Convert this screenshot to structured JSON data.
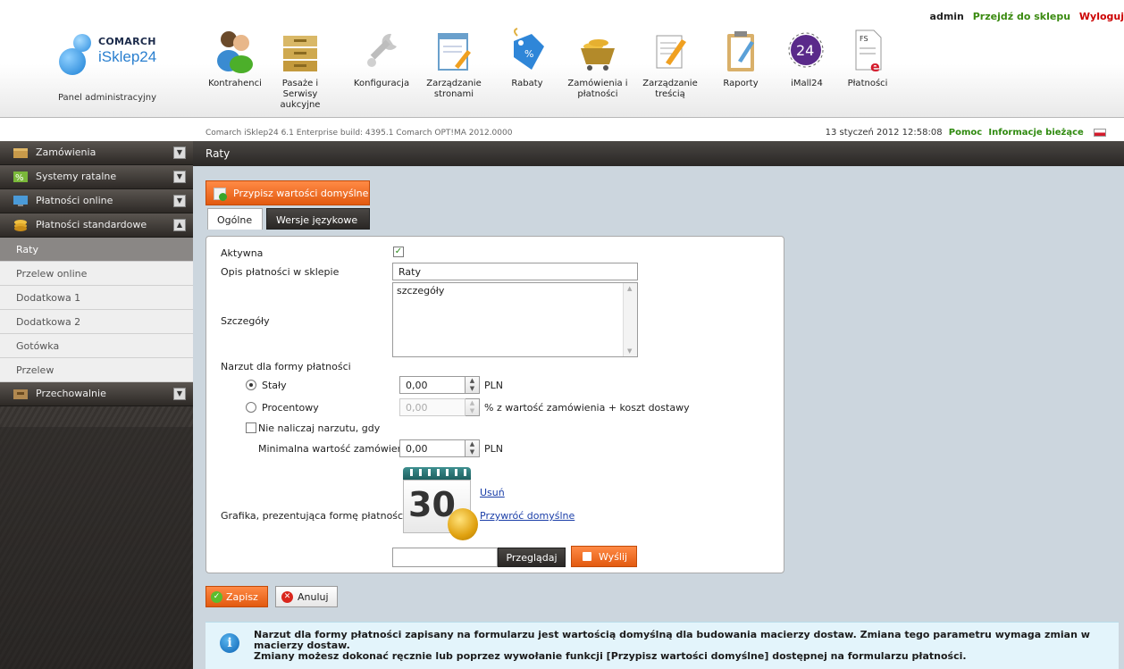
{
  "header": {
    "user": "admin",
    "go_to_shop": "Przejdź do sklepu",
    "logout": "Wyloguj",
    "logo_top": "COMARCH",
    "logo_bottom": "iSklep24",
    "panel_label": "Panel administracyjny"
  },
  "nav": [
    {
      "label": "Kontrahenci",
      "icon": "people-icon"
    },
    {
      "label": "Pasaże i Serwisy aukcyjne",
      "icon": "boxes-icon"
    },
    {
      "label": "Konfiguracja",
      "icon": "wrench-icon"
    },
    {
      "label": "Zarządzanie stronami",
      "icon": "page-edit-icon"
    },
    {
      "label": "Rabaty",
      "icon": "discount-tag-icon"
    },
    {
      "label": "Zamówienia i płatności",
      "icon": "cart-icon"
    },
    {
      "label": "Zarządzanie treścią",
      "icon": "content-edit-icon"
    },
    {
      "label": "Raporty",
      "icon": "clipboard-icon"
    },
    {
      "label": "iMall24",
      "icon": "imall24-icon",
      "badge": "24"
    },
    {
      "label": "Płatności",
      "icon": "fs-e-icon",
      "badge": "FS"
    }
  ],
  "buildbar": {
    "prefix": "Comarch iSklep24 6.1 Enterprise build: 4395.1 Comarch OPT!MA 2012.0000",
    "datetime": "13 styczeń 2012 12:58:08",
    "help": "Pomoc",
    "news": "Informacje bieżące"
  },
  "sidebar": {
    "groups": [
      {
        "label": "Zamówienia",
        "icon": "box-icon"
      },
      {
        "label": "Systemy ratalne",
        "icon": "percent-icon"
      },
      {
        "label": "Płatności online",
        "icon": "monitor-icon"
      },
      {
        "label": "Płatności standardowe",
        "icon": "coins-icon"
      }
    ],
    "sub_items": [
      "Raty",
      "Przelew online",
      "Dodatkowa 1",
      "Dodatkowa 2",
      "Gotówka",
      "Przelew"
    ],
    "last_group": {
      "label": "Przechowalnie",
      "icon": "storage-icon"
    }
  },
  "page": {
    "title": "Raty",
    "defaults_button": "Przypisz wartości domyślne",
    "tabs": [
      "Ogólne",
      "Wersje językowe"
    ]
  },
  "form": {
    "active_label": "Aktywna",
    "desc_label": "Opis płatności w sklepie",
    "desc_value": "Raty",
    "details_label": "Szczegóły",
    "details_value": "szczegóły",
    "surcharge_label": "Narzut dla formy płatności",
    "fixed_label": "Stały",
    "fixed_value": "0,00",
    "currency": "PLN",
    "percent_label": "Procentowy",
    "percent_value": "0,00",
    "percent_suffix": "% z wartość zamówienia + koszt dostawy",
    "no_surcharge_label": "Nie naliczaj narzutu, gdy",
    "min_order_label": "Minimalna wartość zamówienia",
    "min_order_value": "0,00",
    "graphic_label": "Grafika, prezentująca formę płatności",
    "calendar_number": "30",
    "remove_link": "Usuń",
    "restore_link": "Przywróć domyślne",
    "browse_button": "Przeglądaj",
    "send_button": "Wyślij"
  },
  "actions": {
    "save": "Zapisz",
    "cancel": "Anuluj"
  },
  "info": {
    "text1": "Narzut dla formy płatności zapisany na formularzu jest wartością domyślną dla budowania macierzy dostaw. Zmiana tego parametru wymaga zmian w macierzy dostaw.",
    "text2": "Zmiany możesz dokonać ręcznie lub poprzez wywołanie funkcji [Przypisz wartości domyślne] dostępnej na formularzu płatności."
  },
  "colors": {
    "accent_orange": "#e25a10",
    "green_link": "#2f8a0f",
    "logout_red": "#cc0000"
  }
}
